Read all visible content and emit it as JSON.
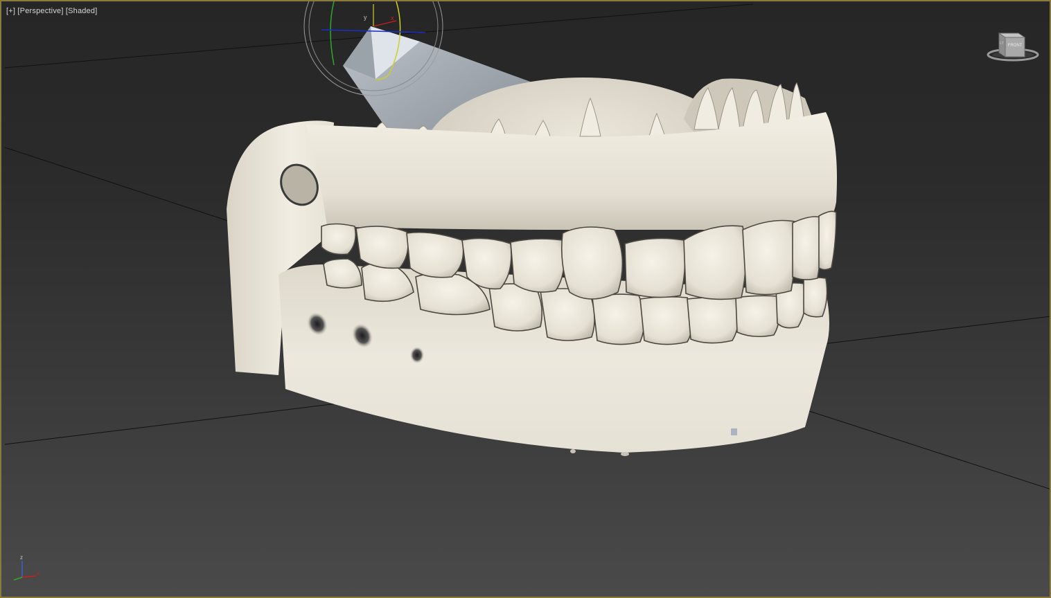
{
  "viewport": {
    "label_plus": "[+]",
    "label_view": "[Perspective]",
    "label_shading": "[Shaded]"
  },
  "viewcube": {
    "face_label": "FRONT",
    "side_label": "LT"
  },
  "gizmo": {
    "x_label": "x",
    "y_label": "y"
  },
  "tripod": {
    "x_label": "x",
    "z_label": "z"
  },
  "colors": {
    "frame_border": "#8a7a3c",
    "model": "#ebe7dc",
    "gizmo_x": "#d01d1d",
    "gizmo_y": "#cfcf2a",
    "gizmo_z": "#1c2ec9",
    "gizmo_ring_green": "#2ea82e"
  }
}
